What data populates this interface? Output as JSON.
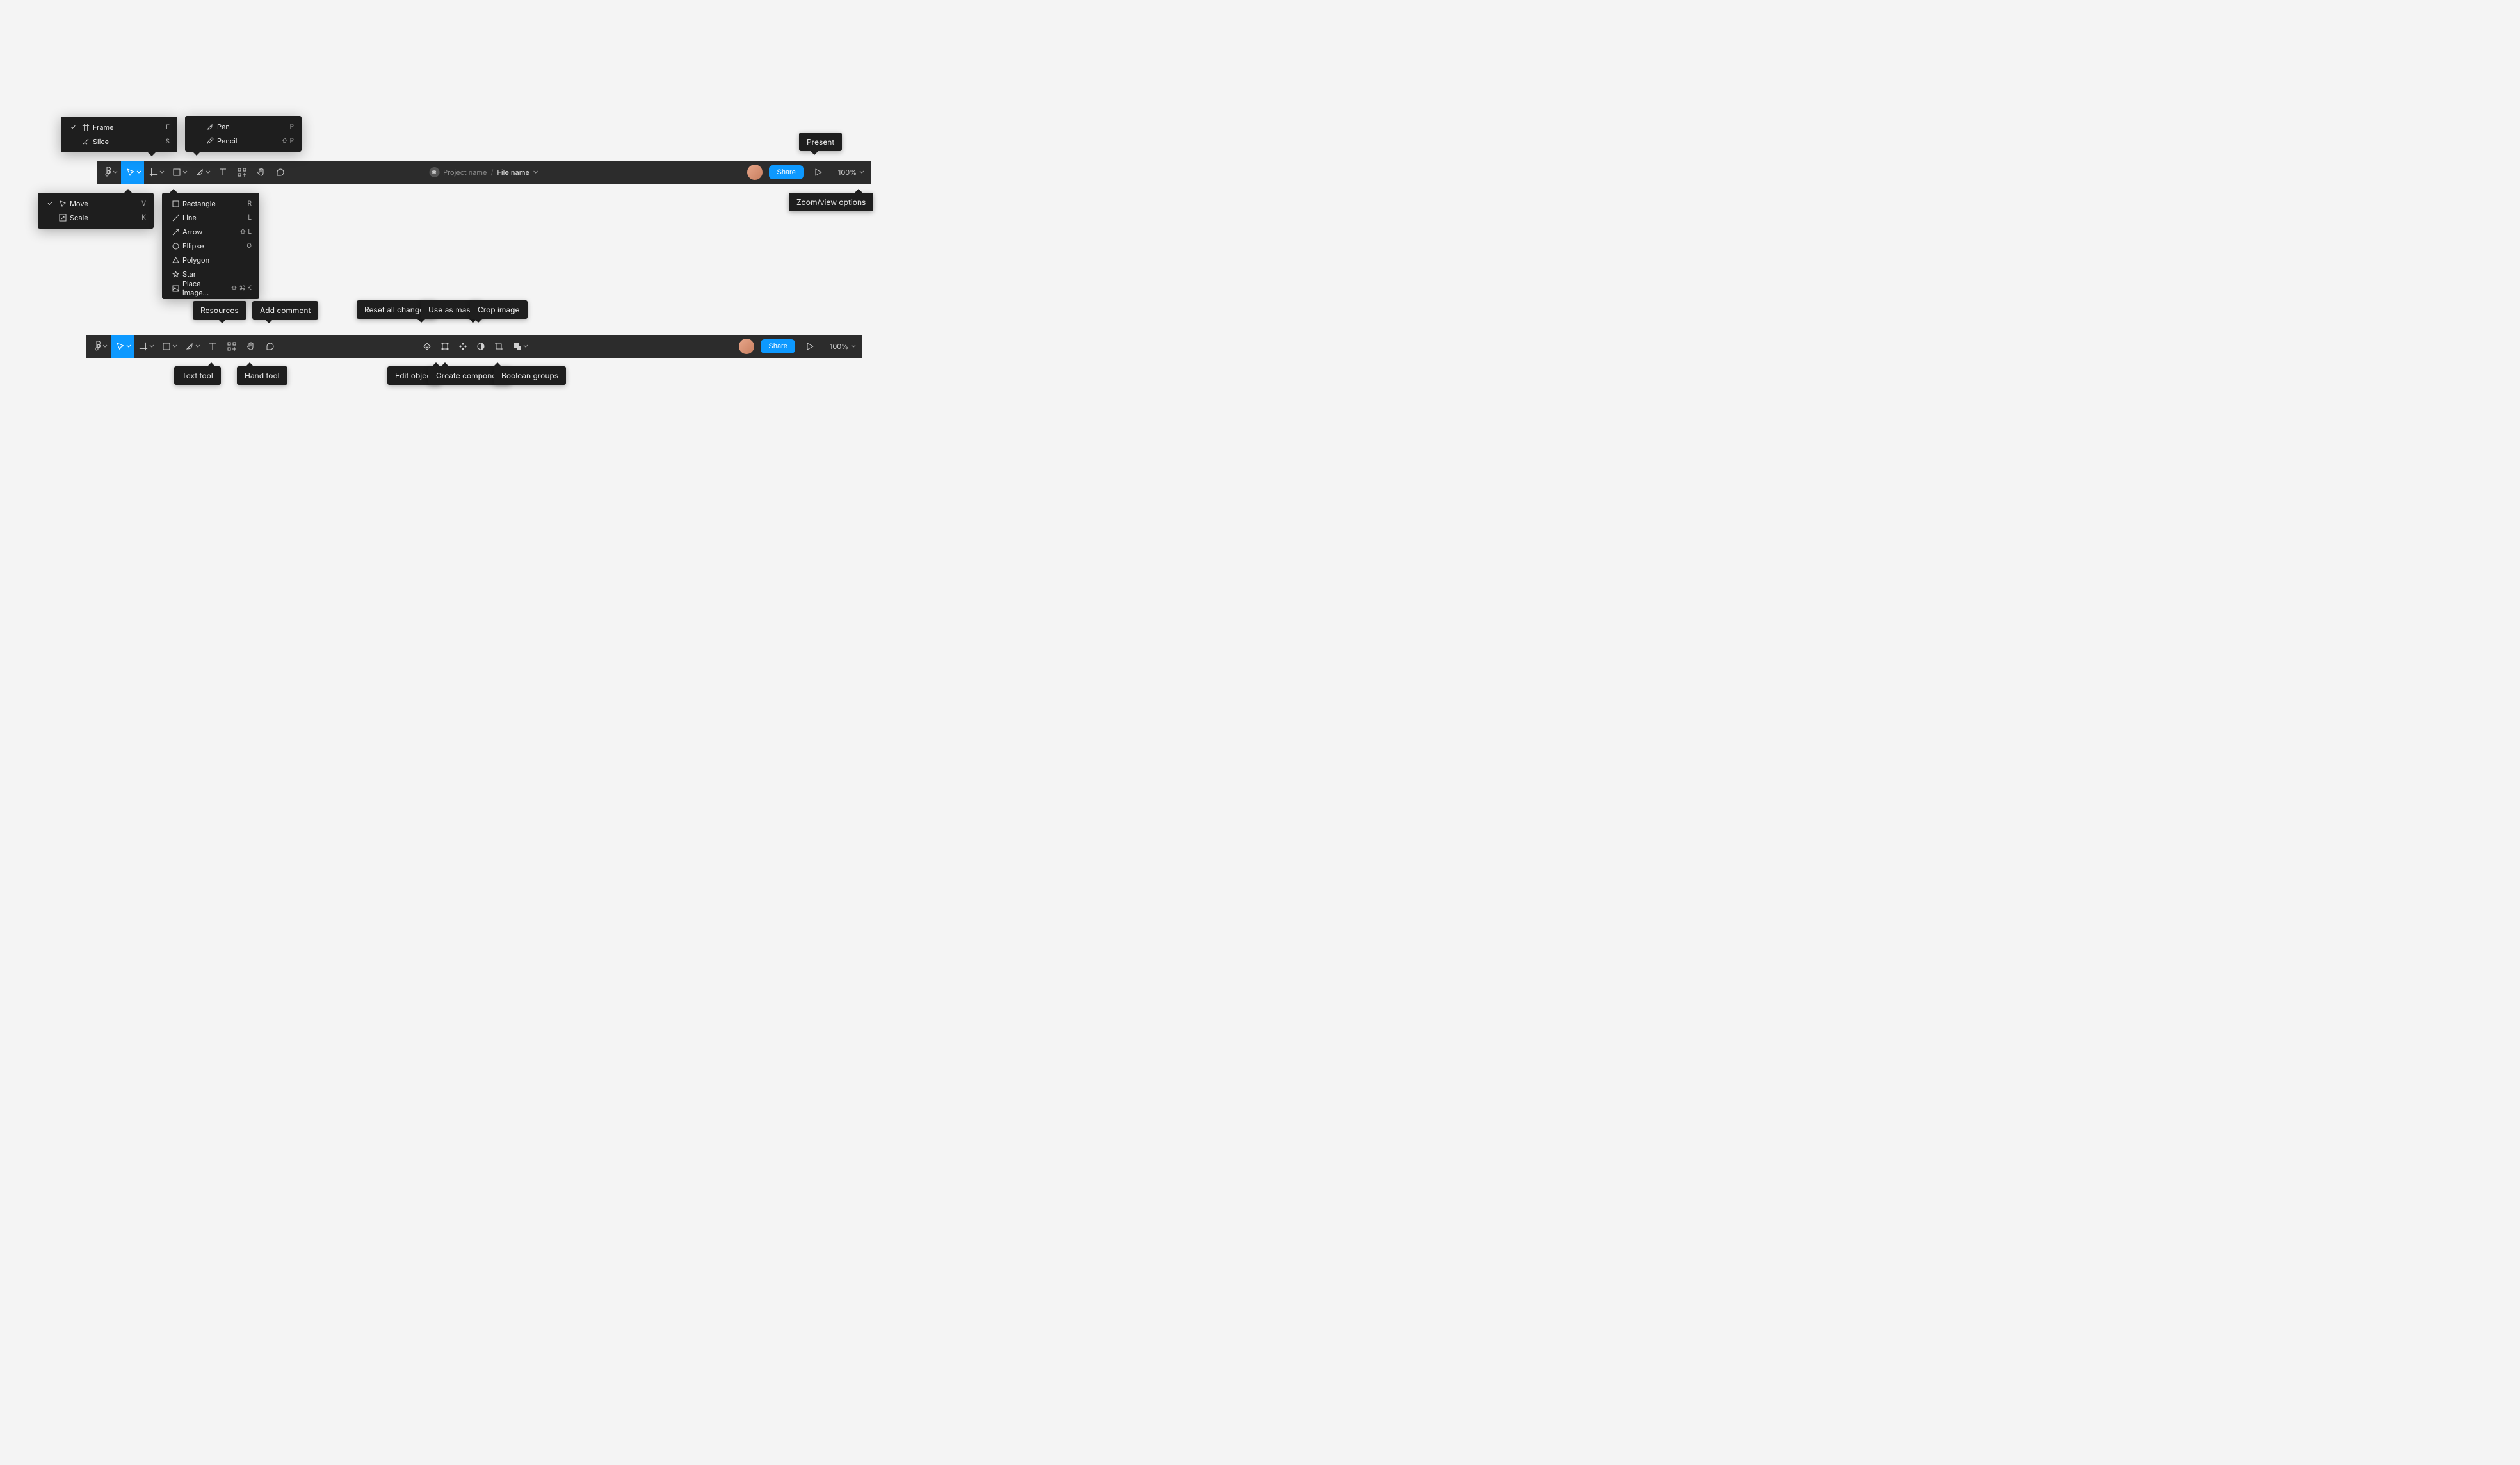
{
  "toolbar1": {
    "move_menu": {
      "items": [
        {
          "label": "Move",
          "key": "V",
          "checked": true
        },
        {
          "label": "Scale",
          "key": "K",
          "checked": false
        }
      ]
    },
    "frame_menu": {
      "items": [
        {
          "label": "Frame",
          "key": "F",
          "checked": true
        },
        {
          "label": "Slice",
          "key": "S",
          "checked": false
        }
      ]
    },
    "pen_menu": {
      "items": [
        {
          "label": "Pen",
          "key": "P"
        },
        {
          "label": "Pencil",
          "key": "⇧ P"
        }
      ]
    },
    "shapes_menu": {
      "items": [
        {
          "label": "Rectangle",
          "key": "R"
        },
        {
          "label": "Line",
          "key": "L"
        },
        {
          "label": "Arrow",
          "key": "⇧ L"
        },
        {
          "label": "Ellipse",
          "key": "O"
        },
        {
          "label": "Polygon",
          "key": ""
        },
        {
          "label": "Star",
          "key": ""
        },
        {
          "label": "Place image...",
          "key": "⇧ ⌘ K"
        }
      ]
    },
    "project": "Project name",
    "file": "File name",
    "share": "Share",
    "zoom": "100%",
    "present_tooltip": "Present",
    "zoom_tooltip": "Zoom/view options"
  },
  "toolbar2": {
    "tooltips_top": {
      "resources": "Resources",
      "add_comment": "Add comment",
      "reset_changes": "Reset all changes",
      "use_mask": "Use as mask",
      "crop": "Crop image"
    },
    "tooltips_bottom": {
      "text_tool": "Text tool",
      "hand_tool": "Hand tool",
      "edit_object": "Edit object",
      "create_component": "Create component",
      "boolean": "Boolean groups"
    },
    "share": "Share",
    "zoom": "100%"
  }
}
